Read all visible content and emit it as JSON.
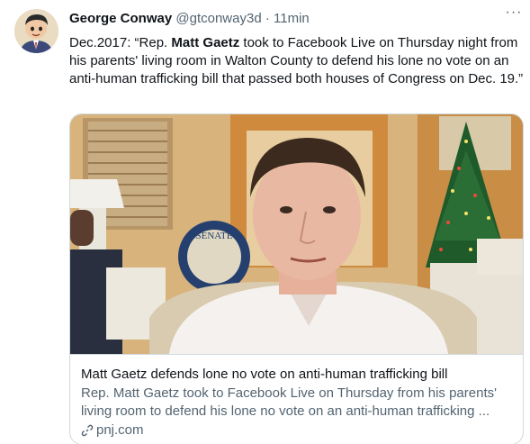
{
  "tweet": {
    "author_name": "George Conway",
    "author_handle": "@gtconway3d",
    "separator": "·",
    "time": "11min",
    "more_label": "···",
    "text_before": "Dec.2017: “Rep. ",
    "text_bold": "Matt Gaetz",
    "text_after": " took to Facebook Live on Thursday night from his parents' living room in Walton County to defend his lone no vote on an anti-human trafficking bill that passed both houses of Congress on Dec. 19.”"
  },
  "card": {
    "title": "Matt Gaetz defends lone no vote on anti-human trafficking bill",
    "description": "Rep. Matt Gaetz took to Facebook Live on Thursday from his parents' living room to defend his lone no vote on an anti-human trafficking ...",
    "domain": "pnj.com",
    "seal_text": "SENATE"
  },
  "icons": {
    "more": "more-horizontal-icon",
    "link": "link-icon"
  }
}
